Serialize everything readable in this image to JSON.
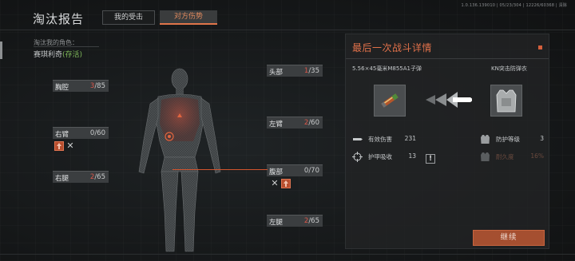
{
  "header": {
    "title": "淘汰报告",
    "tabs": [
      {
        "label": "我的受击",
        "active": false
      },
      {
        "label": "对方伤势",
        "active": true
      }
    ],
    "build_info": "1.0.136.139010 | 05/23/304 | 12226/60368 | 清除"
  },
  "victim": {
    "label": "淘汰我的角色：",
    "name": "赛琪利奇",
    "status": "(存活)"
  },
  "body_parts": {
    "thorax": {
      "name": "胸腔",
      "current": "3",
      "max": "/85"
    },
    "head": {
      "name": "头部",
      "current": "1",
      "max": "/35"
    },
    "right_arm": {
      "name": "右臂",
      "current": "0",
      "max": "/60"
    },
    "left_arm": {
      "name": "左臂",
      "current": "2",
      "max": "/60"
    },
    "stomach": {
      "name": "腹部",
      "current": "0",
      "max": "/70"
    },
    "right_leg": {
      "name": "右腿",
      "current": "2",
      "max": "/65"
    },
    "left_leg": {
      "name": "左腿",
      "current": "2",
      "max": "/65"
    }
  },
  "last_fight": {
    "title": "最后一次战斗详情",
    "ammo_name": "5.56×45毫米M855A1子弹",
    "armor_name": "KN突击防弹衣",
    "stats": {
      "effective_damage_label": "有效伤害",
      "effective_damage_value": "231",
      "armor_absorb_label": "护甲吸收",
      "armor_absorb_value": "13",
      "armor_class_label": "防护等级",
      "armor_class_value": "3",
      "durability_label": "耐久度",
      "durability_value": "16%"
    },
    "continue_label": "继续"
  },
  "colors": {
    "accent": "#e1714a",
    "damage_red": "#d8574a",
    "alive_green": "#7fb85a",
    "button_bg": "#a54f30"
  },
  "icons": {
    "bleed": "bleed-icon",
    "fracture": "fracture-icon",
    "close": "close-icon",
    "warning": "warning-icon"
  }
}
